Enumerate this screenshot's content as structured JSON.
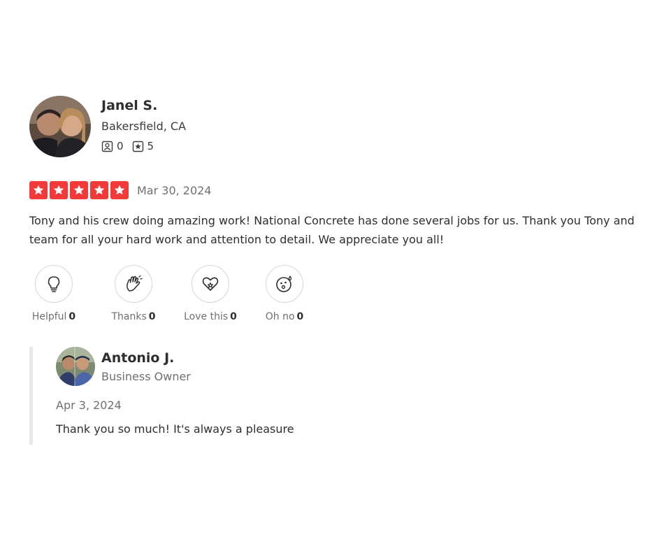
{
  "review": {
    "reviewer": {
      "name": "Janel S.",
      "location": "Bakersfield, CA",
      "friends_count": "0",
      "reviews_count": "5"
    },
    "rating": 5,
    "date": "Mar 30, 2024",
    "text": "Tony and his crew doing amazing work! National Concrete has done several jobs for us. Thank you Tony and team for all your hard work and attention to detail. We appreciate you all!",
    "reactions": [
      {
        "icon": "lightbulb-icon",
        "label": "Helpful",
        "count": "0"
      },
      {
        "icon": "clapping-hands-icon",
        "label": "Thanks",
        "count": "0"
      },
      {
        "icon": "heart-icon",
        "label": "Love this",
        "count": "0"
      },
      {
        "icon": "surprised-face-icon",
        "label": "Oh no",
        "count": "0"
      }
    ]
  },
  "response": {
    "owner_name": "Antonio J.",
    "owner_role": "Business Owner",
    "date": "Apr 3, 2024",
    "text": "Thank you so much! It's always a pleasure"
  },
  "colors": {
    "star_red": "#f43939",
    "text_primary": "#2d2e2f",
    "text_secondary": "#6e7072"
  }
}
